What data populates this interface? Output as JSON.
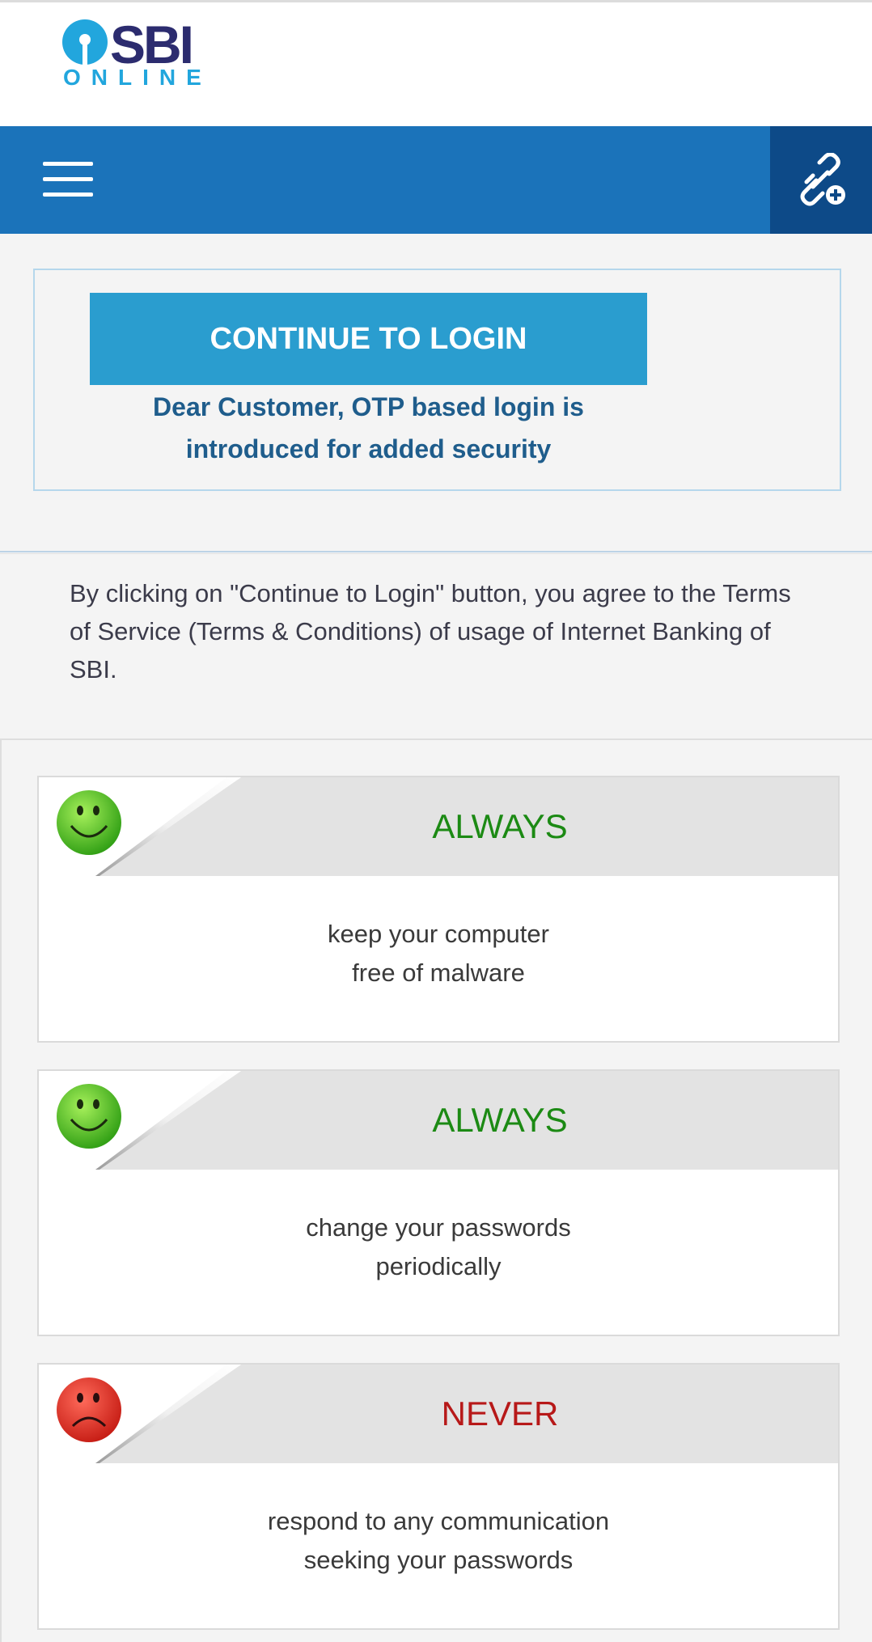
{
  "header": {
    "logo_brand": "SBI",
    "logo_sub": "ONLINE"
  },
  "navbar": {
    "menu_icon": "hamburger-menu-icon",
    "link_icon": "link-add-icon"
  },
  "login_panel": {
    "continue_label": "CONTINUE TO LOGIN",
    "otp_note": "Dear Customer, OTP based login is introduced for added security"
  },
  "terms_text": "By clicking on \"Continue to Login\" button, you agree to the Terms of Service (Terms & Conditions) of usage of Internet Banking of SBI.",
  "tips": [
    {
      "title": "ALWAYS",
      "line1": "keep your computer",
      "line2": "free of malware",
      "mood": "happy"
    },
    {
      "title": "ALWAYS",
      "line1": "change your passwords",
      "line2": "periodically",
      "mood": "happy"
    },
    {
      "title": "NEVER",
      "line1": "respond to any communication",
      "line2": "seeking your passwords",
      "mood": "sad"
    }
  ],
  "colors": {
    "navbar": "#1b73ba",
    "navbar_dark": "#0d4a88",
    "button": "#2a9dcf",
    "always": "#1c8a14",
    "never": "#b71919"
  }
}
